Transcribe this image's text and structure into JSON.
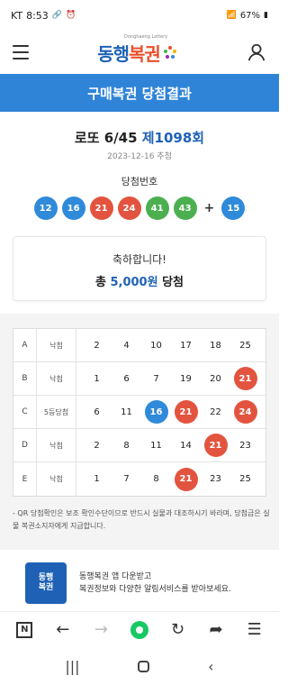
{
  "status_bar": {
    "carrier": "KT",
    "time": "8:53",
    "battery": "67%"
  },
  "header": {
    "logo_text_main": "동행",
    "logo_text_accent": "복권",
    "logo_sub": "Donghaeng Lottery",
    "menu_icon": "hamburger-icon",
    "user_icon": "user-icon"
  },
  "title_bar": {
    "title": "구매복권 당첨결과"
  },
  "round": {
    "name": "로또 6/45",
    "round_no": "제1098회",
    "date": "2023-12-16 추첨",
    "win_numbers_label": "당첨번호",
    "win_numbers": [
      {
        "n": "12",
        "color": "#2f8ad9"
      },
      {
        "n": "16",
        "color": "#2f8ad9"
      },
      {
        "n": "21",
        "color": "#e2543f"
      },
      {
        "n": "24",
        "color": "#e2543f"
      },
      {
        "n": "41",
        "color": "#4caf50"
      },
      {
        "n": "43",
        "color": "#4caf50"
      }
    ],
    "plus": "+",
    "bonus": {
      "n": "15",
      "color": "#2f8ad9"
    }
  },
  "congrats": {
    "line1": "축하합니다!",
    "prefix": "총 ",
    "amount": "5,000원",
    "suffix": " 당첨"
  },
  "results": [
    {
      "game": "A",
      "result": "낙첨",
      "numbers": [
        {
          "n": "2"
        },
        {
          "n": "4"
        },
        {
          "n": "10"
        },
        {
          "n": "17"
        },
        {
          "n": "18"
        },
        {
          "n": "25"
        }
      ]
    },
    {
      "game": "B",
      "result": "낙첨",
      "numbers": [
        {
          "n": "1"
        },
        {
          "n": "6"
        },
        {
          "n": "7"
        },
        {
          "n": "19"
        },
        {
          "n": "20"
        },
        {
          "n": "21",
          "hit": "red"
        }
      ]
    },
    {
      "game": "C",
      "result": "5등당첨",
      "numbers": [
        {
          "n": "6"
        },
        {
          "n": "11"
        },
        {
          "n": "16",
          "hit": "blue"
        },
        {
          "n": "21",
          "hit": "red"
        },
        {
          "n": "22"
        },
        {
          "n": "24",
          "hit": "red"
        }
      ]
    },
    {
      "game": "D",
      "result": "낙첨",
      "numbers": [
        {
          "n": "2"
        },
        {
          "n": "8"
        },
        {
          "n": "11"
        },
        {
          "n": "14"
        },
        {
          "n": "21",
          "hit": "red"
        },
        {
          "n": "23"
        }
      ]
    },
    {
      "game": "E",
      "result": "낙첨",
      "numbers": [
        {
          "n": "1"
        },
        {
          "n": "7"
        },
        {
          "n": "8"
        },
        {
          "n": "21",
          "hit": "red"
        },
        {
          "n": "23"
        },
        {
          "n": "25"
        }
      ]
    }
  ],
  "notice": "- QR 당첨확인은 보조 확인수단이므로 반드시 실물과 대조하시기 바라며, 당첨금은 실물 복권소지자에게 지급합니다.",
  "promo": {
    "logo_line1": "동행",
    "logo_line2": "복권",
    "line1": "동행복권 앱 다운받고",
    "line2": "복권정보와 다양한 알림서비스를 받아보세요."
  },
  "browser_bar": {
    "icons": [
      "n-icon",
      "back-arrow-icon",
      "forward-arrow-icon",
      "green-home-icon",
      "refresh-icon",
      "share-icon",
      "menu-lines-icon"
    ],
    "n_label": "N"
  }
}
